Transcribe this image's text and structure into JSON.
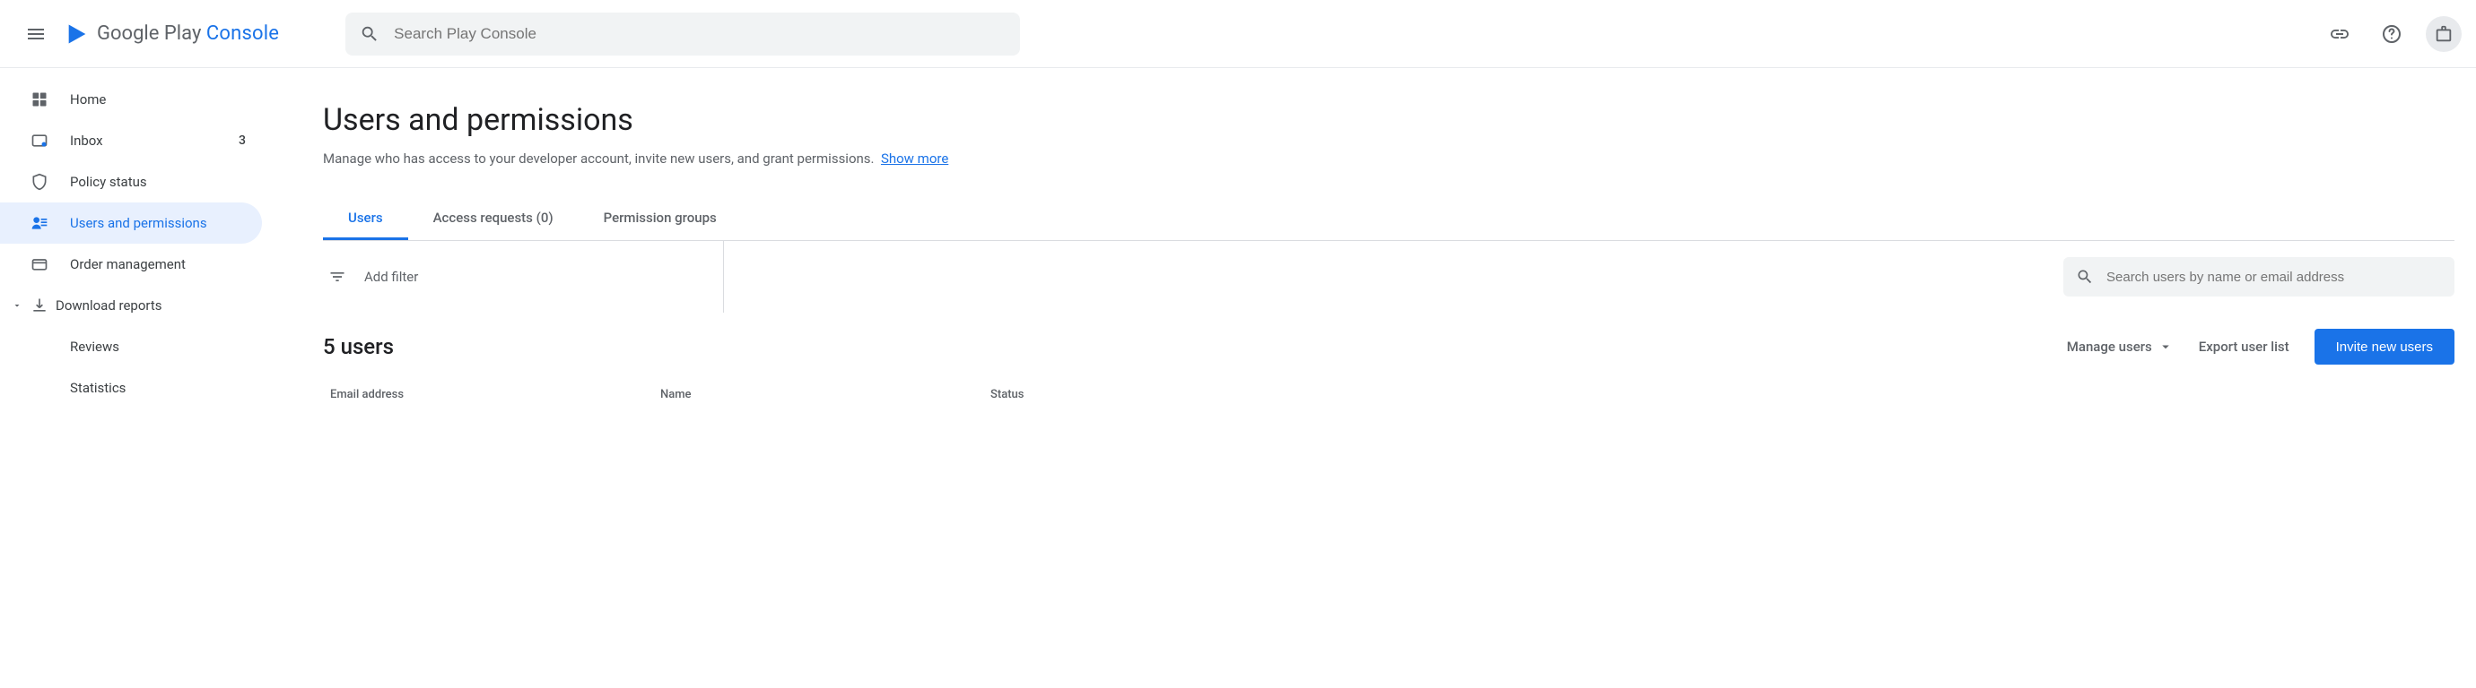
{
  "header": {
    "logo_text_1": "Google Play",
    "logo_text_2": "Console",
    "search_placeholder": "Search Play Console"
  },
  "sidebar": {
    "items": [
      {
        "label": "Home"
      },
      {
        "label": "Inbox",
        "badge": "3"
      },
      {
        "label": "Policy status"
      },
      {
        "label": "Users and permissions"
      },
      {
        "label": "Order management"
      },
      {
        "label": "Download reports"
      },
      {
        "label": "Reviews"
      },
      {
        "label": "Statistics"
      }
    ]
  },
  "main": {
    "title": "Users and permissions",
    "subtitle": "Manage who has access to your developer account, invite new users, and grant permissions.",
    "show_more": "Show more",
    "tabs": [
      {
        "label": "Users"
      },
      {
        "label": "Access requests (0)"
      },
      {
        "label": "Permission groups"
      }
    ],
    "add_filter": "Add filter",
    "user_search_placeholder": "Search users by name or email address",
    "section_title": "5 users",
    "manage_users": "Manage users",
    "export": "Export user list",
    "invite": "Invite new users",
    "columns": {
      "email": "Email address",
      "name": "Name",
      "status": "Status"
    }
  }
}
